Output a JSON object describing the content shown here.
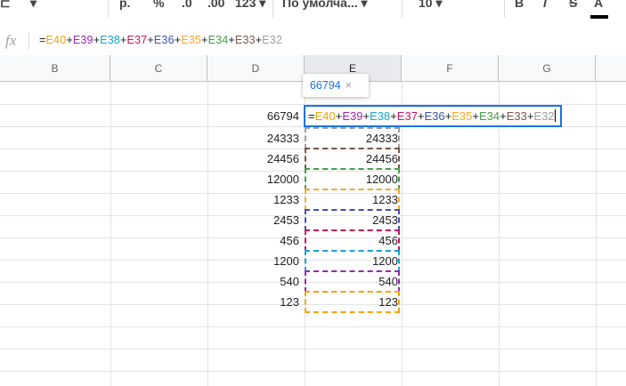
{
  "toolbar": {
    "items": [
      "р.",
      "%",
      ".0",
      ".00",
      "123 ▾",
      "По умолча... ▾",
      "10 ▾",
      "B",
      "I",
      "S",
      "A"
    ]
  },
  "formula_bar": {
    "fx_label": "fx",
    "formula": "=E40+E39+E38+E37+E36+E35+E34+E33+E32"
  },
  "columns": [
    "B",
    "C",
    "D",
    "E",
    "F",
    "G"
  ],
  "active_column": "E",
  "tooltip": {
    "value": "66794",
    "close": "×"
  },
  "total_cell": {
    "column_d_value": "66794"
  },
  "rows": [
    {
      "d": "24333",
      "e": "24333"
    },
    {
      "d": "24456",
      "e": "24456"
    },
    {
      "d": "12000",
      "e": "12000"
    },
    {
      "d": "1233",
      "e": "1233"
    },
    {
      "d": "2453",
      "e": "2453"
    },
    {
      "d": "456",
      "e": "456"
    },
    {
      "d": "1200",
      "e": "1200"
    },
    {
      "d": "540",
      "e": "540"
    },
    {
      "d": "123",
      "e": "123"
    }
  ],
  "formula_tokens": [
    {
      "text": "=",
      "color": "#202124"
    },
    {
      "text": "E40",
      "color": "#f4a300"
    },
    {
      "text": "+",
      "color": "#202124"
    },
    {
      "text": "E39",
      "color": "#9c27b0"
    },
    {
      "text": "+",
      "color": "#202124"
    },
    {
      "text": "E38",
      "color": "#12a4d6"
    },
    {
      "text": "+",
      "color": "#202124"
    },
    {
      "text": "E37",
      "color": "#c2185b"
    },
    {
      "text": "+",
      "color": "#202124"
    },
    {
      "text": "E36",
      "color": "#3f51b5"
    },
    {
      "text": "+",
      "color": "#202124"
    },
    {
      "text": "E35",
      "color": "#f9a825"
    },
    {
      "text": "+",
      "color": "#202124"
    },
    {
      "text": "E34",
      "color": "#43a047"
    },
    {
      "text": "+",
      "color": "#202124"
    },
    {
      "text": "E33",
      "color": "#795548"
    },
    {
      "text": "+",
      "color": "#202124"
    },
    {
      "text": "E32",
      "color": "#9e9e9e"
    }
  ],
  "ref_colors": [
    "#9e9e9e",
    "#795548",
    "#43a047",
    "#f9a825",
    "#3f51b5",
    "#c2185b",
    "#12a4d6",
    "#9c27b0",
    "#f4a300"
  ]
}
